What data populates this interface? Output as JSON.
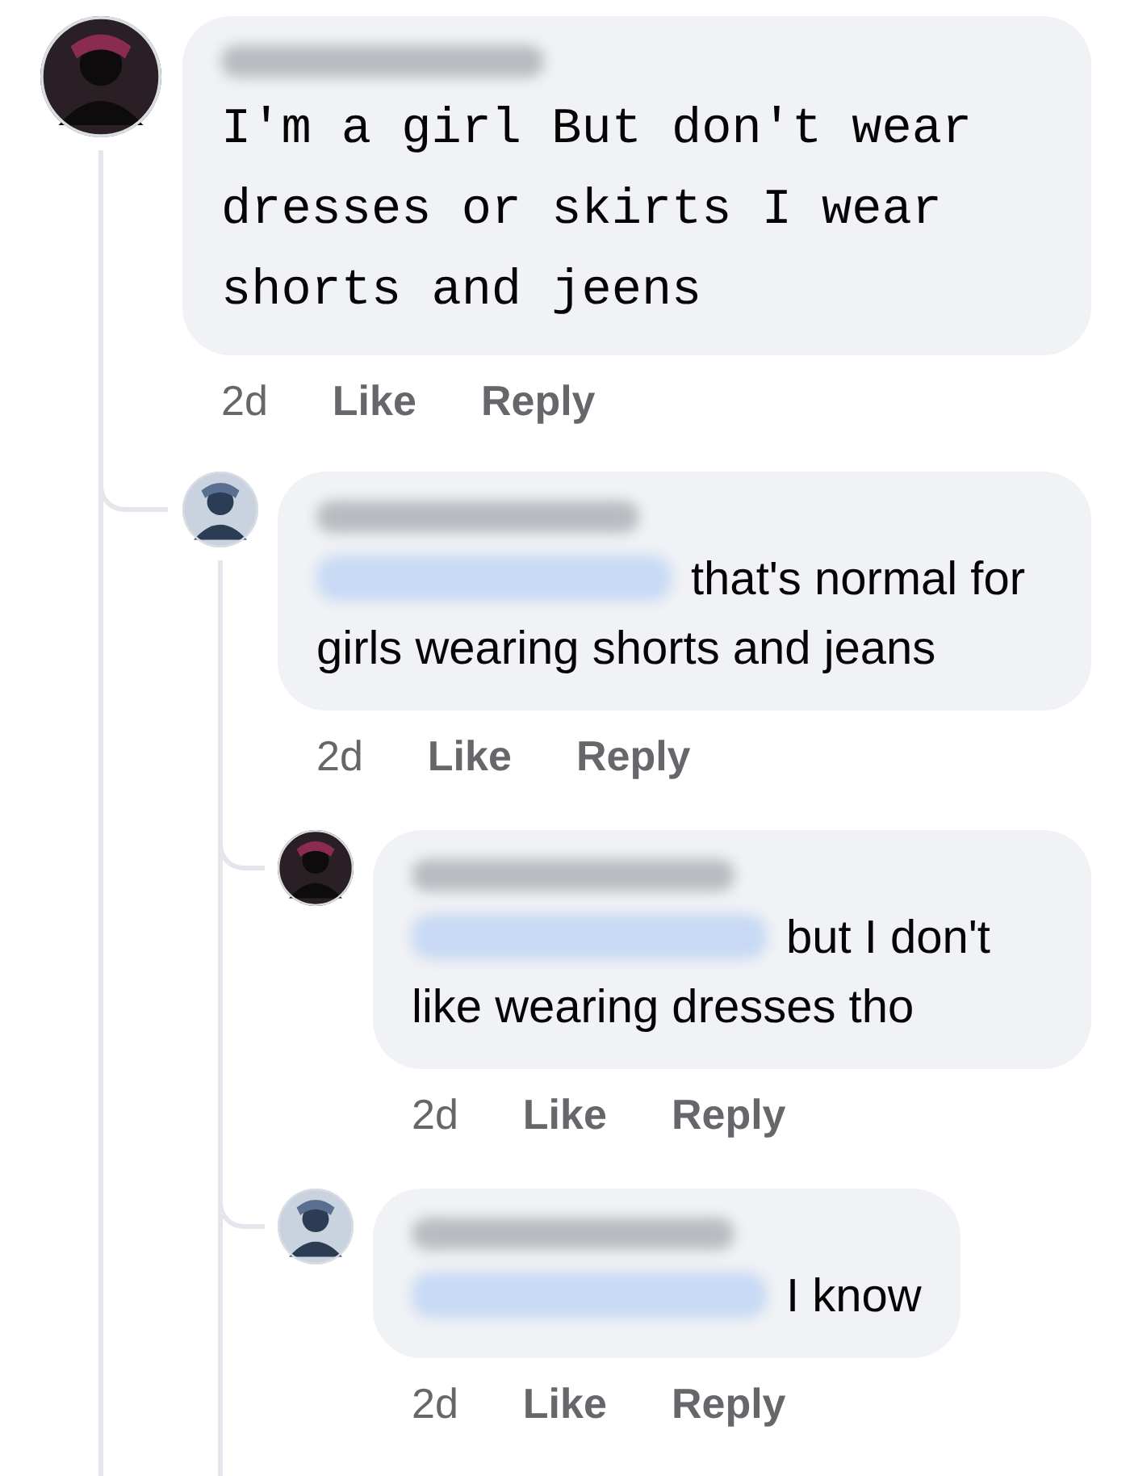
{
  "comments": [
    {
      "kind": "typewriter",
      "has_mention": false,
      "body": "I'm a girl But  don't wear dresses or skirts I wear shorts and jeens",
      "time": "2d",
      "actions": [
        "Like",
        "Reply"
      ],
      "avatar": {
        "kind": "picture"
      },
      "children": [
        {
          "kind": "plain",
          "has_mention": true,
          "body": "that's normal for girls wearing shorts and jeans",
          "time": "2d",
          "actions": [
            "Like",
            "Reply"
          ],
          "avatar": {
            "kind": "picture"
          },
          "children": [
            {
              "kind": "plain",
              "has_mention": true,
              "body": "but I don't like wearing dresses tho",
              "time": "2d",
              "actions": [
                "Like",
                "Reply"
              ],
              "avatar": {
                "kind": "picture"
              }
            },
            {
              "kind": "plain",
              "has_mention": true,
              "body": "I know",
              "time": "2d",
              "actions": [
                "Like",
                "Reply"
              ],
              "avatar": {
                "kind": "picture"
              }
            }
          ]
        }
      ]
    }
  ]
}
